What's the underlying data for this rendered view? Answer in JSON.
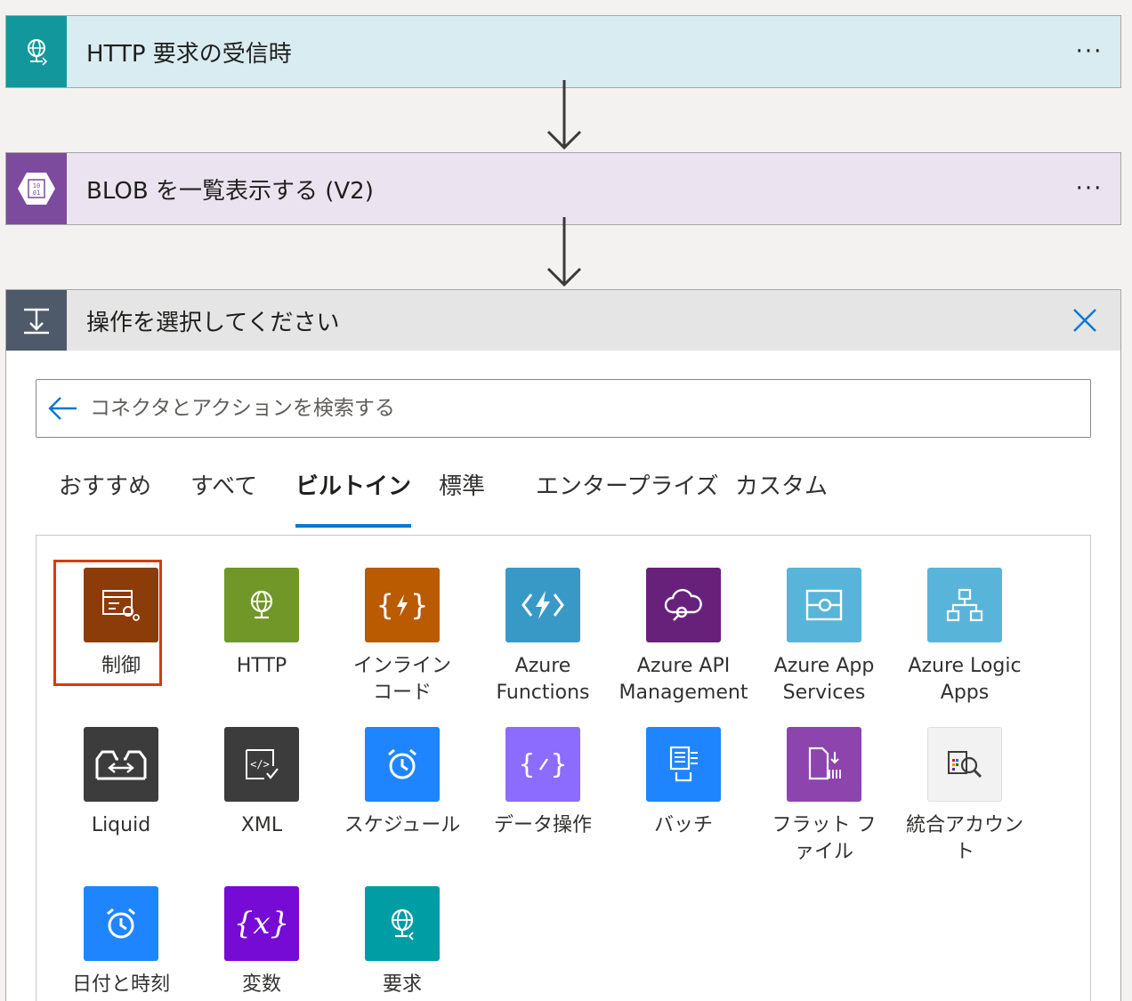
{
  "steps": [
    {
      "title": "HTTP 要求の受信時",
      "more_label": "···",
      "icon": "http-request-icon",
      "accent": "#12989c"
    },
    {
      "title": "BLOB を一覧表示する (V2)",
      "more_label": "···",
      "icon": "blob-storage-icon",
      "accent": "#7c4b9d"
    }
  ],
  "panel": {
    "title": "操作を選択してください",
    "icon": "action-placeholder-icon",
    "close_icon": "close-icon",
    "search_placeholder": "コネクタとアクションを検索する"
  },
  "tabs": [
    {
      "label": "おすすめ",
      "active": false
    },
    {
      "label": "すべて",
      "active": false
    },
    {
      "label": "ビルトイン",
      "active": true
    },
    {
      "label": "標準",
      "active": false
    },
    {
      "label": "エンタープライズ",
      "active": false
    },
    {
      "label": "カスタム",
      "active": false
    }
  ],
  "connectors": [
    {
      "label": "制御",
      "icon": "control-icon",
      "color": "#8c3c08",
      "selected": true
    },
    {
      "label": "HTTP",
      "icon": "globe-icon",
      "color": "#709727"
    },
    {
      "label": "インライン\nコード",
      "icon": "inline-code-icon",
      "color": "#ba5a01"
    },
    {
      "label": "Azure\nFunctions",
      "icon": "functions-icon",
      "color": "#3999c6"
    },
    {
      "label": "Azure API\nManagement",
      "icon": "api-management-icon",
      "color": "#68217a"
    },
    {
      "label": "Azure App\nServices",
      "icon": "app-services-icon",
      "color": "#59b4d9"
    },
    {
      "label": "Azure Logic\nApps",
      "icon": "logic-apps-icon",
      "color": "#59b4d9"
    },
    {
      "label": "Liquid",
      "icon": "liquid-icon",
      "color": "#3c3c3c"
    },
    {
      "label": "XML",
      "icon": "xml-icon",
      "color": "#3c3c3c"
    },
    {
      "label": "スケジュール",
      "icon": "alarm-clock-icon",
      "color": "#1f85ff"
    },
    {
      "label": "データ操作",
      "icon": "data-operations-icon",
      "color": "#8c6cff"
    },
    {
      "label": "バッチ",
      "icon": "batch-icon",
      "color": "#1f85ff"
    },
    {
      "label": "フラット フ\nァイル",
      "icon": "flat-file-icon",
      "color": "#8d44ad"
    },
    {
      "label": "統合アカウン\nト",
      "icon": "integration-account-icon",
      "color": "#f2f2f2"
    },
    {
      "label": "日付と時刻",
      "icon": "date-time-icon",
      "color": "#1f85ff"
    },
    {
      "label": "変数",
      "icon": "variables-icon",
      "color": "#770bd6"
    },
    {
      "label": "要求",
      "icon": "request-icon",
      "color": "#009da5"
    }
  ]
}
